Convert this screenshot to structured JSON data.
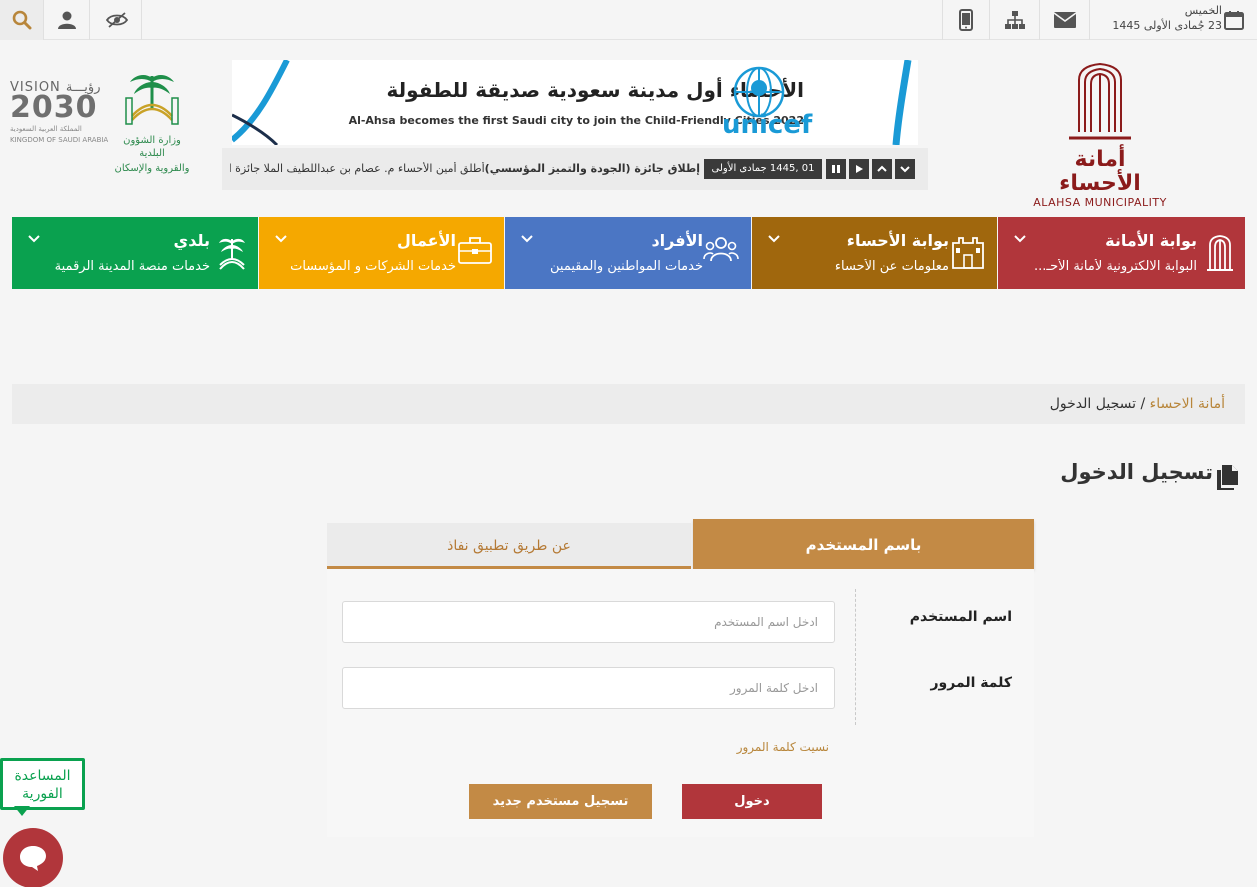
{
  "topbar": {
    "day": "الخميس",
    "hijri_date": "23 جُمادى الأولى 1445"
  },
  "header": {
    "vision_label": "VISION رؤيـــة",
    "vision_year": "2030",
    "vision_sub_ar": "المملكة العربية السعودية",
    "vision_sub_en": "KINGDOM OF SAUDI ARABIA",
    "ministry_line1": "وزارة الشؤون البلدية",
    "ministry_line2": "والقروية والإسكان",
    "logo_ar": "أمانة الأحساء",
    "logo_en": "ALAHSA MUNICIPALITY"
  },
  "banner": {
    "title_ar": "الأحساء أول مدينة سعودية صديقة للطفولة",
    "title_en": "Al-Ahsa becomes the first Saudi city to join the Child-Friendly Cities 2022",
    "brand": "unicef"
  },
  "ticker": {
    "date": "01 ,1445 جمادى الأولى",
    "headline_bold": "إطلاق جائزة (الجودة والتميز المؤسسي)",
    "headline_text": "أطلق أمين الأحساء م. عصام بن عبداللطيف الملا جائزة الأمين ل..."
  },
  "nav": {
    "tiles": [
      {
        "title": "بوابة الأمانة",
        "sub": "البوابة الالكترونية لأمانة الأحـ..."
      },
      {
        "title": "بوابة الأحساء",
        "sub": "معلومات عن الأحساء"
      },
      {
        "title": "الأفراد",
        "sub": "خدمات المواطنين والمقيمين"
      },
      {
        "title": "الأعمال",
        "sub": "خدمات الشركات و المؤسسات"
      },
      {
        "title": "بلدي",
        "sub": "خدمات منصة المدينة الرقمية"
      }
    ]
  },
  "breadcrumb": {
    "home": "أمانة الاحساء",
    "separator": " / ",
    "current": "تسجيل الدخول"
  },
  "page": {
    "title": "تسجيل الدخول"
  },
  "login": {
    "tab_username": "باسم المستخدم",
    "tab_nafath": "عن طريق تطبيق نفاذ",
    "username_label": "اسم المستخدم",
    "username_placeholder": "ادخل اسم المستخدم",
    "password_label": "كلمة المرور",
    "password_placeholder": "ادخل كلمة المرور",
    "forgot": "نسيت كلمة المرور",
    "login_button": "دخول",
    "register_button": "تسجيل مستخدم جديد"
  },
  "help": {
    "line1": "المساعدة",
    "line2": "الفورية"
  },
  "colors": {
    "amanah": "#b1363b",
    "ahsa": "#a0670d",
    "individuals": "#4b76c4",
    "business": "#f5a800",
    "balady": "#0aa14f",
    "accent_gold": "#c38a45"
  }
}
